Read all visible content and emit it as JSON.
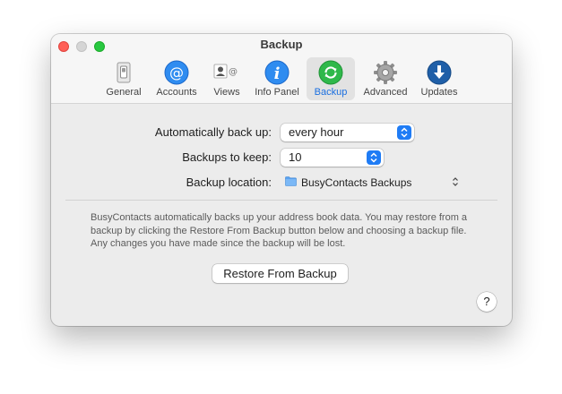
{
  "window": {
    "title": "Backup"
  },
  "toolbar": {
    "tabs": [
      {
        "label": "General",
        "icon": "general-switch-icon"
      },
      {
        "label": "Accounts",
        "icon": "at-sign-icon"
      },
      {
        "label": "Views",
        "icon": "views-icon"
      },
      {
        "label": "Info Panel",
        "icon": "info-icon"
      },
      {
        "label": "Backup",
        "icon": "backup-refresh-icon",
        "active": true
      },
      {
        "label": "Advanced",
        "icon": "gear-icon"
      },
      {
        "label": "Updates",
        "icon": "download-arrow-icon"
      }
    ]
  },
  "form": {
    "auto_backup": {
      "label": "Automatically back up:",
      "value": "every hour"
    },
    "backups_keep": {
      "label": "Backups to keep:",
      "value": "10"
    },
    "location": {
      "label": "Backup location:",
      "value": "BusyContacts Backups"
    }
  },
  "description": "BusyContacts automatically backs up your address book data. You may restore from a backup by clicking the Restore From Backup button below and choosing a backup file. Any changes you have made since the backup will be lost.",
  "restore_button": "Restore From Backup",
  "help_button": "?",
  "colors": {
    "accent": "#1f7cf5",
    "active_tab_label": "#1a6fe0"
  }
}
